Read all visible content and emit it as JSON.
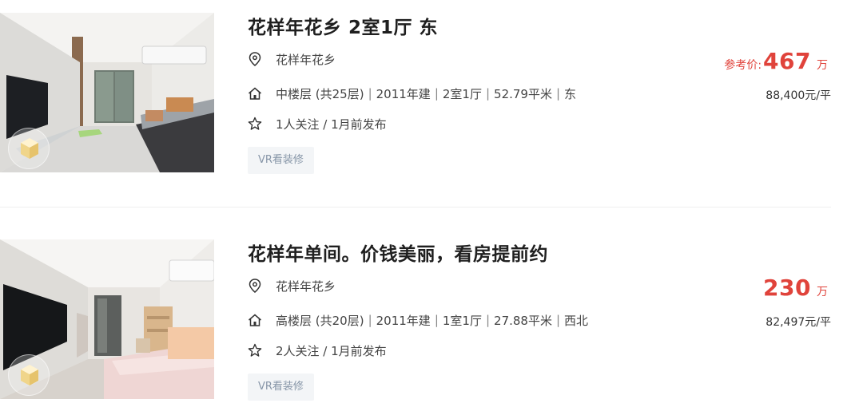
{
  "listings": [
    {
      "title": "花样年花乡 2室1厅 东",
      "community": "花样年花乡",
      "floor": "中楼层 (共25层)",
      "year": "2011年建",
      "layout": "2室1厅",
      "area": "52.79平米",
      "orientation": "东",
      "follow": "1人关注 / 1月前发布",
      "tag": "VR看装修",
      "price_prefix": "参考价:",
      "price": "467",
      "price_unit": "万",
      "unit_price": "88,400元/平"
    },
    {
      "title": "花样年单间。价钱美丽，看房提前约",
      "community": "花样年花乡",
      "floor": "高楼层 (共20层)",
      "year": "2011年建",
      "layout": "1室1厅",
      "area": "27.88平米",
      "orientation": "西北",
      "follow": "2人关注 / 1月前发布",
      "tag": "VR看装修",
      "price_prefix": "",
      "price": "230",
      "price_unit": "万",
      "unit_price": "82,497元/平"
    }
  ],
  "colors": {
    "price": "#e0433b",
    "tag_text": "#8796a8",
    "tag_bg": "#f3f5f7"
  },
  "icons": {
    "location": "location-pin-icon",
    "house": "house-icon",
    "follow": "star-icon",
    "vr": "vr-cube-icon"
  }
}
